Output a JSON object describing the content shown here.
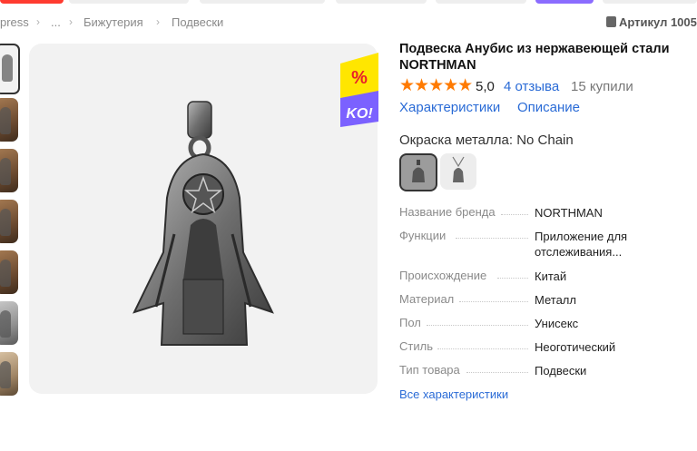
{
  "breadcrumb": {
    "items": [
      "press",
      "...",
      "Бижутерия",
      "Подвески"
    ],
    "separator": "›"
  },
  "article_label": "Артикул 1005",
  "product": {
    "title": "Подвеска Анубис из нержавеющей стали NORTHMAN",
    "rating": "5,0",
    "stars": "★★★★★",
    "reviews": "4 отзыва",
    "bought": "15 купили",
    "rating_value": 5.0
  },
  "tabs": [
    "Характеристики",
    "Описание"
  ],
  "color": {
    "label": "Окраска металла: No Chain",
    "selected_index": 0
  },
  "badge": {
    "percent": "%",
    "ko": "KO!"
  },
  "specs": [
    {
      "key": "Название бренда",
      "value": "NORTHMAN"
    },
    {
      "key": "Функции",
      "value": "Приложение для отслеживания..."
    },
    {
      "key": "Происхождение",
      "value": "Китай"
    },
    {
      "key": "Материал",
      "value": "Металл"
    },
    {
      "key": "Пол",
      "value": "Унисекс"
    },
    {
      "key": "Стиль",
      "value": "Неоготический"
    },
    {
      "key": "Тип товара",
      "value": "Подвески"
    }
  ],
  "all_specs_link": "Все характеристики",
  "colors": {
    "accent": "#2a6bd6",
    "star": "#ff7a00",
    "badge_yellow": "#ffe600",
    "badge_purple": "#7b61ff"
  }
}
